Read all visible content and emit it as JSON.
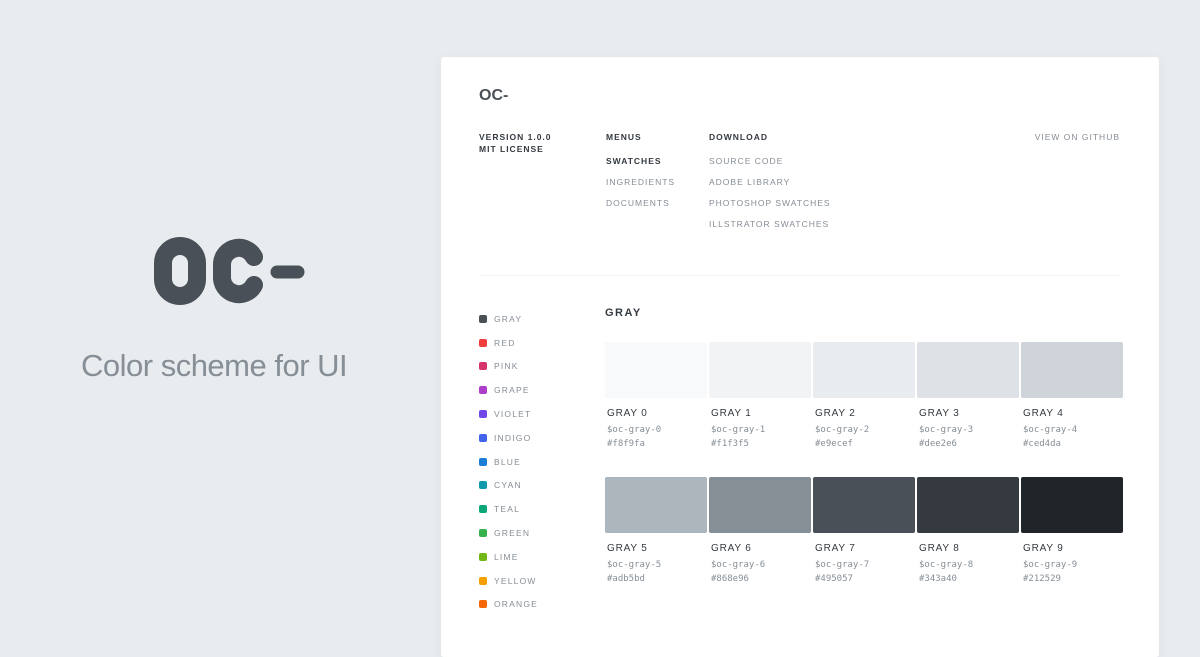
{
  "hero": {
    "logo": "OC-",
    "tagline": "Color scheme for UI",
    "logo_color": "#495057"
  },
  "header": {
    "logo": "OC-",
    "version": "VERSION 1.0.0",
    "license": "MIT LICENSE",
    "menus": {
      "title": "MENUS",
      "items": [
        "SWATCHES",
        "INGREDIENTS",
        "DOCUMENTS"
      ],
      "active": "SWATCHES"
    },
    "download": {
      "title": "DOWNLOAD",
      "items": [
        "SOURCE CODE",
        "ADOBE LIBRARY",
        "PHOTOSHOP SWATCHES",
        "ILLSTRATOR SWATCHES"
      ]
    },
    "github": "VIEW ON GITHUB"
  },
  "sidebar": [
    {
      "label": "GRAY",
      "color": "#495057"
    },
    {
      "label": "RED",
      "color": "#f03e3e"
    },
    {
      "label": "PINK",
      "color": "#d6336c"
    },
    {
      "label": "GRAPE",
      "color": "#ae3ec9"
    },
    {
      "label": "VIOLET",
      "color": "#7048e8"
    },
    {
      "label": "INDIGO",
      "color": "#4263eb"
    },
    {
      "label": "BLUE",
      "color": "#1c7ed6"
    },
    {
      "label": "CYAN",
      "color": "#1098ad"
    },
    {
      "label": "TEAL",
      "color": "#0ca678"
    },
    {
      "label": "GREEN",
      "color": "#37b24d"
    },
    {
      "label": "LIME",
      "color": "#74b816"
    },
    {
      "label": "YELLOW",
      "color": "#f59f00"
    },
    {
      "label": "ORANGE",
      "color": "#f76707"
    }
  ],
  "section": {
    "title": "GRAY",
    "swatches": [
      {
        "name": "GRAY 0",
        "var": "$oc-gray-0",
        "hex": "#f8f9fa"
      },
      {
        "name": "GRAY 1",
        "var": "$oc-gray-1",
        "hex": "#f1f3f5"
      },
      {
        "name": "GRAY 2",
        "var": "$oc-gray-2",
        "hex": "#e9ecef"
      },
      {
        "name": "GRAY 3",
        "var": "$oc-gray-3",
        "hex": "#dee2e6"
      },
      {
        "name": "GRAY 4",
        "var": "$oc-gray-4",
        "hex": "#ced4da"
      },
      {
        "name": "GRAY 5",
        "var": "$oc-gray-5",
        "hex": "#adb5bd"
      },
      {
        "name": "GRAY 6",
        "var": "$oc-gray-6",
        "hex": "#868e96"
      },
      {
        "name": "GRAY 7",
        "var": "$oc-gray-7",
        "hex": "#495057"
      },
      {
        "name": "GRAY 8",
        "var": "$oc-gray-8",
        "hex": "#343a40"
      },
      {
        "name": "GRAY 9",
        "var": "$oc-gray-9",
        "hex": "#212529"
      }
    ]
  }
}
